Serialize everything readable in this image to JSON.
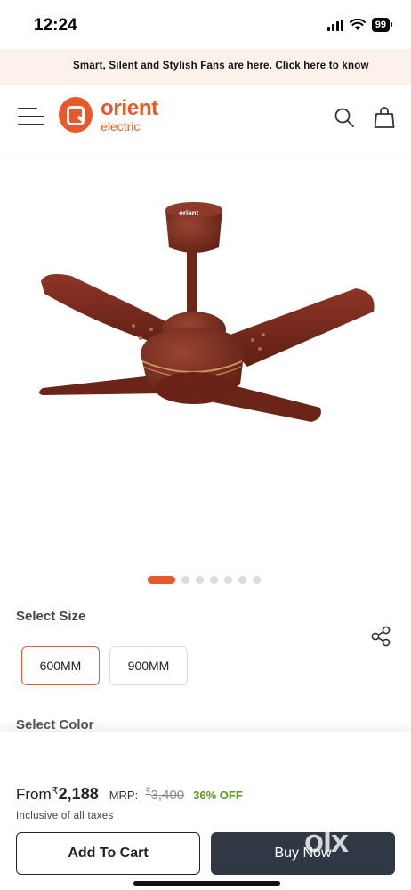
{
  "status_bar": {
    "time": "12:24",
    "battery": "99"
  },
  "announcement": {
    "text": "Smart, Silent and Stylish Fans are here. Click here to know"
  },
  "header": {
    "brand_name": "orient",
    "brand_sub": "electric",
    "icons": [
      "menu-icon",
      "search-icon",
      "shopping-bag-icon"
    ]
  },
  "product": {
    "image_icon": "ceiling-fan",
    "fan_logo": "orient",
    "fan_color": "#7a2b1e",
    "carousel": {
      "total": 7,
      "active": 0
    }
  },
  "size": {
    "label": "Select Size",
    "options": [
      "600MM",
      "900MM"
    ],
    "selected": "600MM"
  },
  "color": {
    "label": "Select Color"
  },
  "pricing": {
    "from_label": "From",
    "currency": "₹",
    "price": "2,188",
    "mrp_label": "MRP:",
    "mrp_value": "3,400",
    "discount": "36% OFF",
    "tax_note": "Inclusive of all taxes"
  },
  "actions": {
    "add_to_cart": "Add To Cart",
    "buy_now": "Buy Now"
  },
  "watermark": "olx",
  "colors": {
    "accent": "#e8582b",
    "dark_button": "#303846",
    "discount_green": "#5a9a1c"
  }
}
